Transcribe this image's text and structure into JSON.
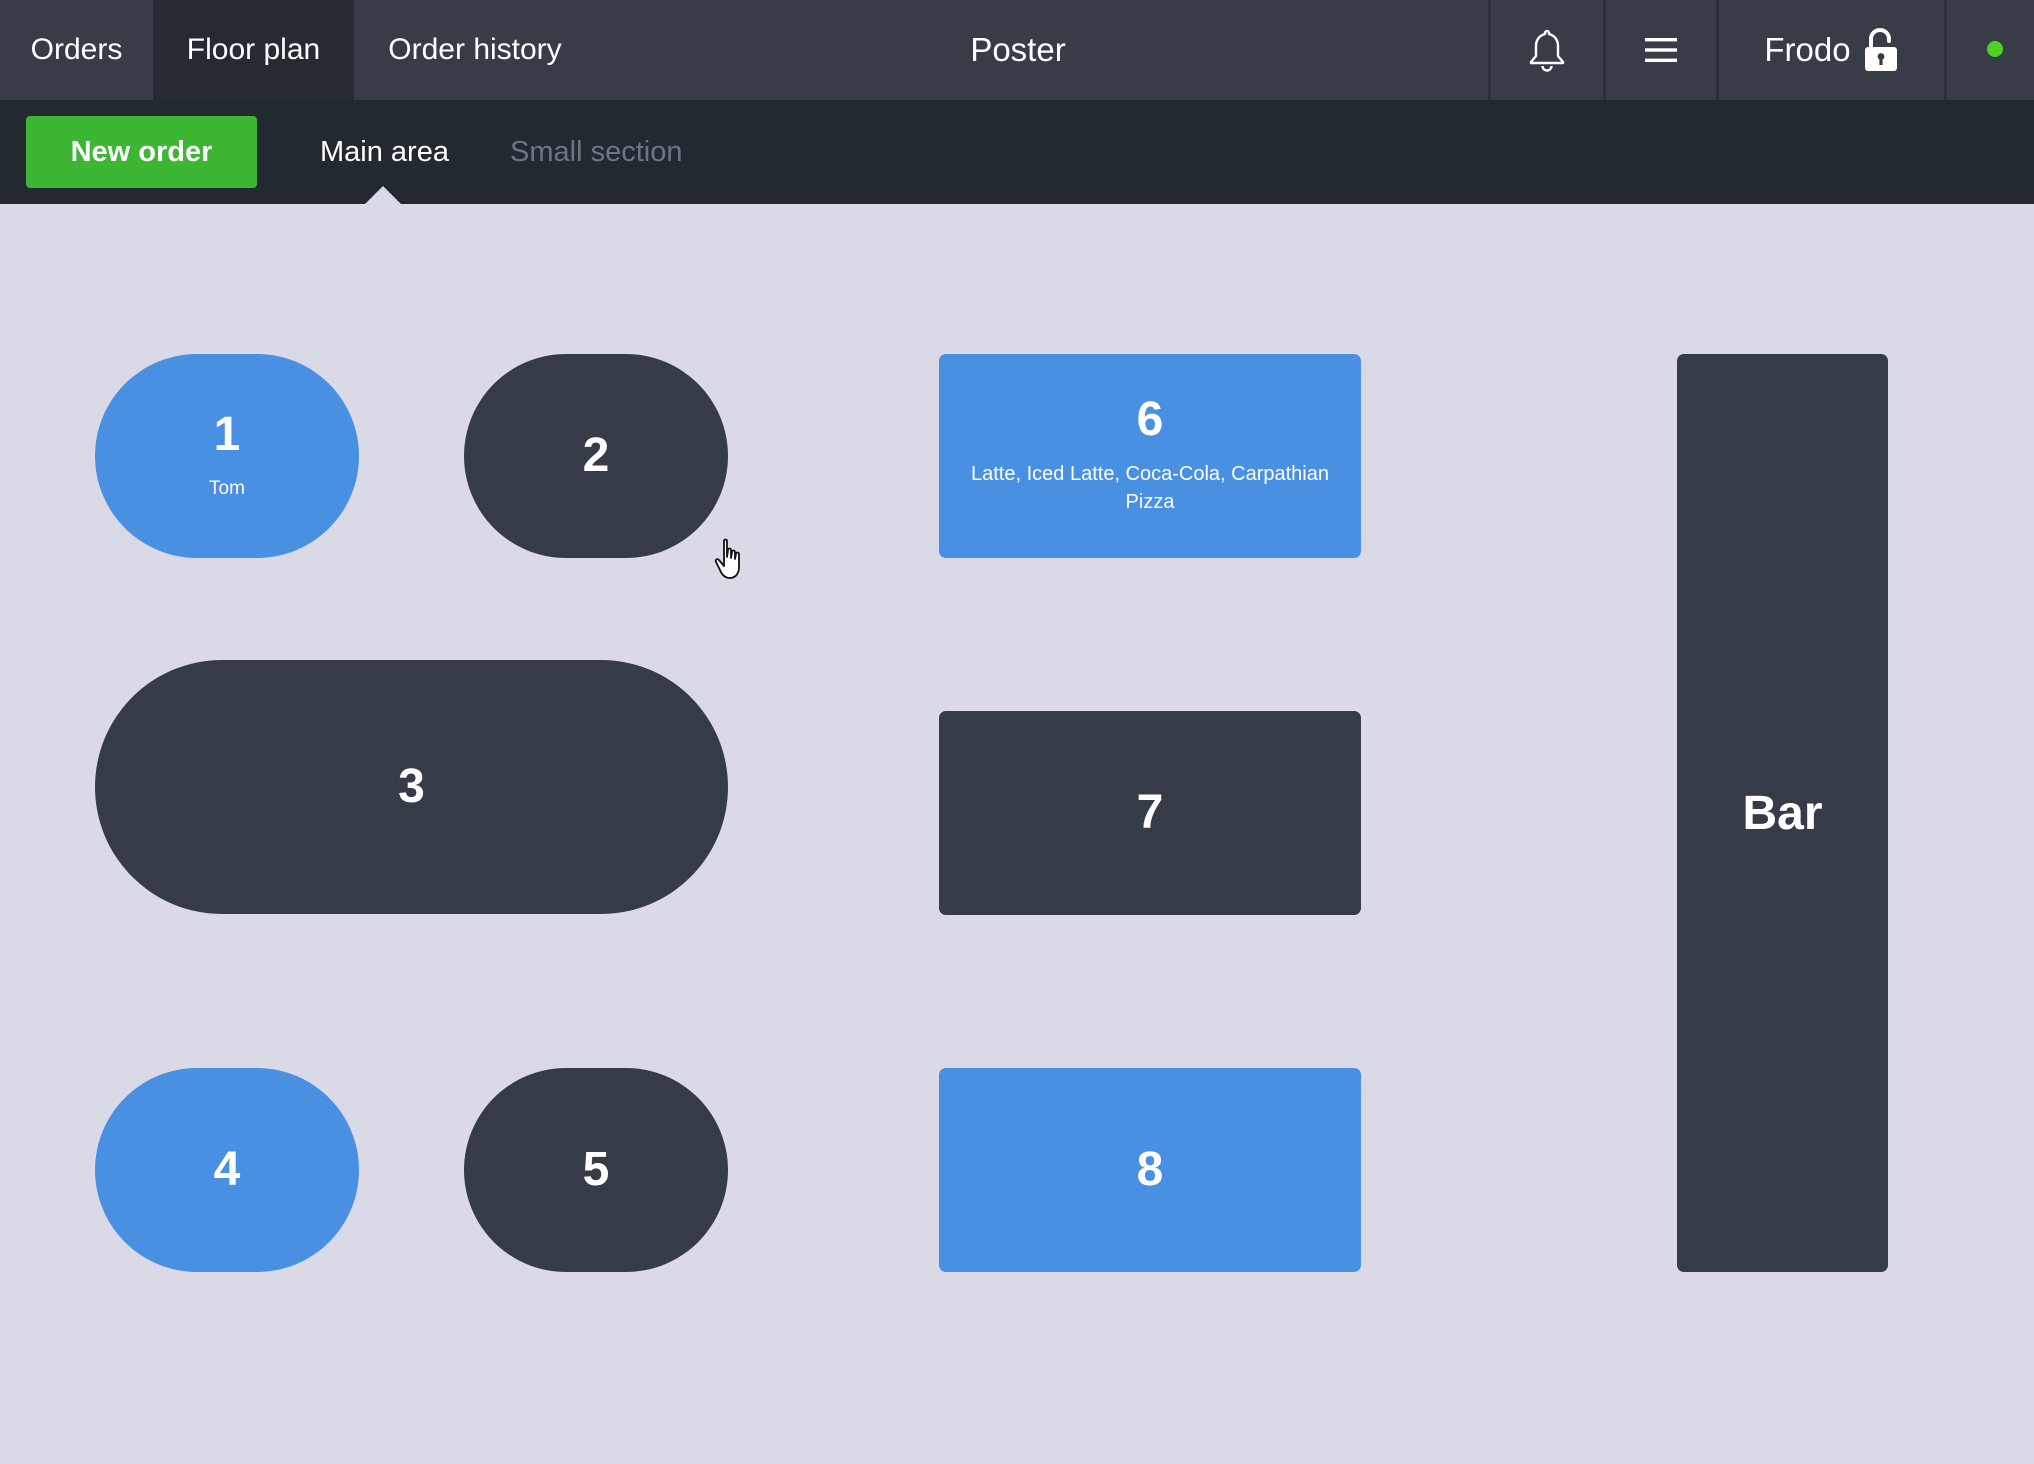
{
  "header": {
    "tabs": [
      {
        "label": "Orders"
      },
      {
        "label": "Floor plan",
        "active": true
      },
      {
        "label": "Order history"
      }
    ],
    "app_title": "Poster",
    "user_name": "Frodo",
    "icons": {
      "notifications": "bell-icon",
      "menu": "hamburger-menu-icon",
      "lock": "unlocked-padlock-icon",
      "status": "online-status-dot"
    },
    "status_color": "#4fcf28"
  },
  "subbar": {
    "new_order_label": "New order",
    "new_order_color": "#3db634",
    "areas": [
      {
        "label": "Main area",
        "active": true
      },
      {
        "label": "Small section",
        "active": false
      }
    ]
  },
  "floor": {
    "colors": {
      "occupied": "#4a90e2",
      "free": "#363c47",
      "background": "#d9dae6"
    },
    "tables": [
      {
        "number": "1",
        "shape": "round",
        "status": "occupied",
        "note": "Tom"
      },
      {
        "number": "2",
        "shape": "round",
        "status": "free"
      },
      {
        "number": "3",
        "shape": "round",
        "status": "free"
      },
      {
        "number": "4",
        "shape": "round",
        "status": "occupied"
      },
      {
        "number": "5",
        "shape": "round",
        "status": "free"
      },
      {
        "number": "6",
        "shape": "rect",
        "status": "occupied",
        "items": "Latte, Iced Latte, Coca-Cola, Carpathian Pizza"
      },
      {
        "number": "7",
        "shape": "rect",
        "status": "free"
      },
      {
        "number": "8",
        "shape": "rect",
        "status": "occupied"
      }
    ],
    "bar": {
      "label": "Bar",
      "status": "free"
    }
  }
}
